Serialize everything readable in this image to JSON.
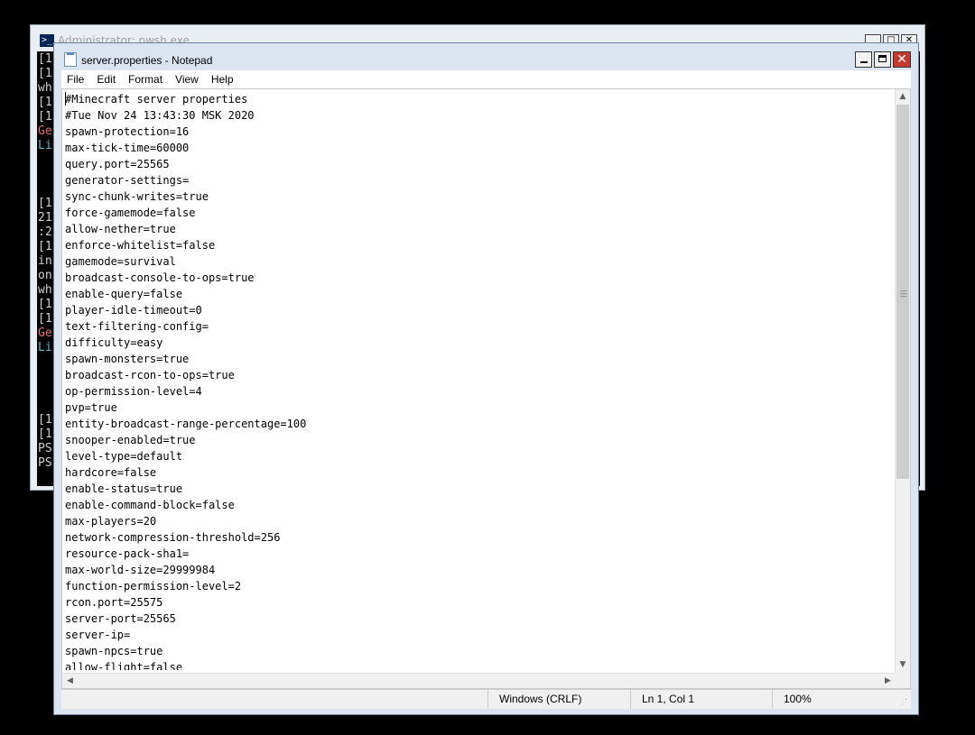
{
  "background_window": {
    "title": "Administrator: pwsh.exe",
    "icon": "powershell-icon",
    "console_colors": {
      "background": "#000000",
      "text": "#d0d0d0",
      "red": "#e06c6c",
      "cyan": "#5fb8c7"
    },
    "visible_line_fragments": [
      {
        "text": "[1",
        "color": "#d0d0d0"
      },
      {
        "text": "[1",
        "color": "#d0d0d0"
      },
      {
        "text": "wh",
        "color": "#d0d0d0"
      },
      {
        "text": "[1",
        "color": "#d0d0d0"
      },
      {
        "text": "[1",
        "color": "#d0d0d0"
      },
      {
        "text": "Ge",
        "color": "#e06c6c"
      },
      {
        "text": "Li",
        "color": "#5fb8c7"
      },
      {
        "text": "",
        "color": "#d0d0d0"
      },
      {
        "text": "",
        "color": "#d0d0d0"
      },
      {
        "text": "",
        "color": "#d0d0d0"
      },
      {
        "text": "[1",
        "color": "#d0d0d0"
      },
      {
        "text": "21",
        "color": "#d0d0d0"
      },
      {
        "text": ":2",
        "color": "#d0d0d0"
      },
      {
        "text": "[1",
        "color": "#d0d0d0"
      },
      {
        "text": "in",
        "color": "#d0d0d0"
      },
      {
        "text": "on",
        "color": "#d0d0d0"
      },
      {
        "text": "wh",
        "color": "#d0d0d0"
      },
      {
        "text": "[1",
        "color": "#d0d0d0"
      },
      {
        "text": "[1",
        "color": "#d0d0d0"
      },
      {
        "text": "Ge",
        "color": "#e06c6c"
      },
      {
        "text": "Li",
        "color": "#5fb8c7"
      },
      {
        "text": "",
        "color": "#d0d0d0"
      },
      {
        "text": "",
        "color": "#d0d0d0"
      },
      {
        "text": "",
        "color": "#d0d0d0"
      },
      {
        "text": "",
        "color": "#d0d0d0"
      },
      {
        "text": "[1",
        "color": "#d0d0d0"
      },
      {
        "text": "[1",
        "color": "#d0d0d0"
      },
      {
        "text": "PS",
        "color": "#d0d0d0"
      },
      {
        "text": "PS",
        "color": "#d0d0d0"
      }
    ]
  },
  "notepad": {
    "title": "server.properties - Notepad",
    "menu": [
      "File",
      "Edit",
      "Format",
      "View",
      "Help"
    ],
    "lines": [
      "#Minecraft server properties",
      "#Tue Nov 24 13:43:30 MSK 2020",
      "spawn-protection=16",
      "max-tick-time=60000",
      "query.port=25565",
      "generator-settings=",
      "sync-chunk-writes=true",
      "force-gamemode=false",
      "allow-nether=true",
      "enforce-whitelist=false",
      "gamemode=survival",
      "broadcast-console-to-ops=true",
      "enable-query=false",
      "player-idle-timeout=0",
      "text-filtering-config=",
      "difficulty=easy",
      "spawn-monsters=true",
      "broadcast-rcon-to-ops=true",
      "op-permission-level=4",
      "pvp=true",
      "entity-broadcast-range-percentage=100",
      "snooper-enabled=true",
      "level-type=default",
      "hardcore=false",
      "enable-status=true",
      "enable-command-block=false",
      "max-players=20",
      "network-compression-threshold=256",
      "resource-pack-sha1=",
      "max-world-size=29999984",
      "function-permission-level=2",
      "rcon.port=25575",
      "server-port=25565",
      "server-ip=",
      "spawn-npcs=true",
      "allow-flight=false"
    ],
    "status": {
      "encoding": "Windows (CRLF)",
      "position": "Ln 1, Col 1",
      "zoom": "100%"
    },
    "icons": {
      "app": "notepad-icon",
      "minimize": "minimize-icon",
      "maximize": "maximize-icon",
      "close": "close-icon"
    }
  }
}
